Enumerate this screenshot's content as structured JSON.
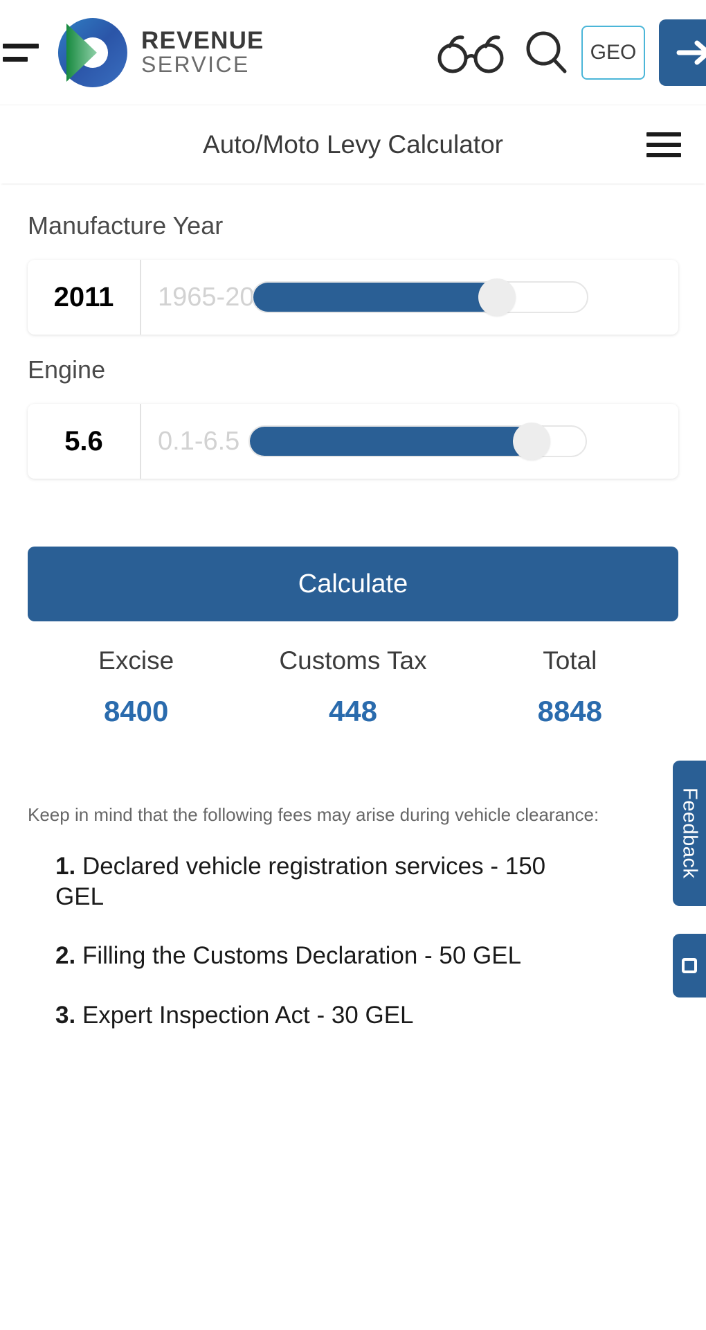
{
  "header": {
    "menu_icon": "hamburger-icon",
    "logo": {
      "line1": "REVENUE",
      "line2": "SERVICE",
      "mark": "revenue-service-logo-icon"
    },
    "accessibility_icon": "glasses-icon",
    "search_icon": "search-icon",
    "language_button": "GEO",
    "login_icon": "login-arrow-icon"
  },
  "titlebar": {
    "title": "Auto/Moto Levy Calculator",
    "menu_icon": "hamburger-icon"
  },
  "form": {
    "year": {
      "label": "Manufacture Year",
      "value": "2011",
      "range_hint": "1965-20",
      "slider_percent": 73
    },
    "engine": {
      "label": "Engine",
      "value": "5.6",
      "range_hint": "0.1-6.5",
      "slider_percent": 84
    },
    "calculate_label": "Calculate"
  },
  "results": [
    {
      "label": "Excise",
      "value": "8400"
    },
    {
      "label": "Customs Tax",
      "value": "448"
    },
    {
      "label": "Total",
      "value": "8848"
    }
  ],
  "notes": {
    "intro": "Keep in mind that the following fees may arise during vehicle clearance:",
    "items": [
      {
        "num": "1.",
        "text": "Declared vehicle registration services - 150 GEL"
      },
      {
        "num": "2.",
        "text": "Filling the Customs Declaration - 50 GEL"
      },
      {
        "num": "3.",
        "text": "Expert Inspection Act - 30 GEL"
      }
    ]
  },
  "side": {
    "feedback_label": "Feedback",
    "second_tab_icon": "chat-icon"
  },
  "colors": {
    "accent_blue": "#2a5f95",
    "result_blue": "#2a6bad",
    "geo_border": "#4bb6d8"
  }
}
